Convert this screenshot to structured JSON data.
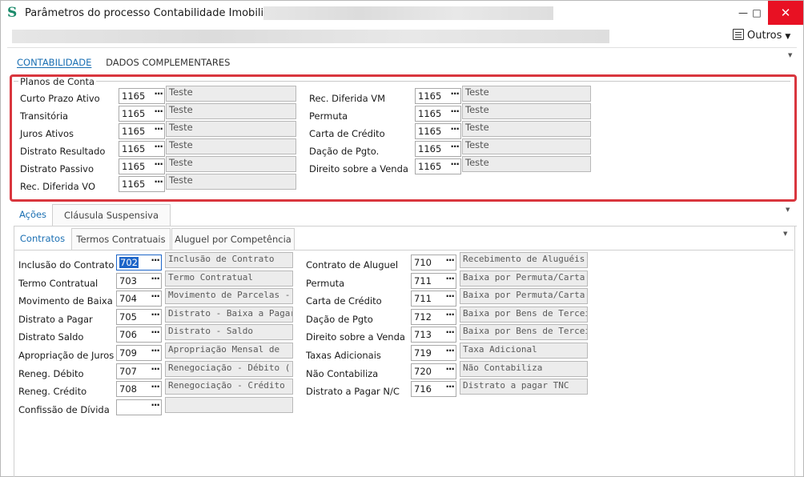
{
  "window": {
    "title": "Parâmetros do processo Contabilidade Imobiliária",
    "app_icon": "S",
    "minimize_glyph": "—",
    "maximize_glyph": "□",
    "close_glyph": "✕"
  },
  "toolbar": {
    "outros_label": "Outros",
    "outros_caret": "▼"
  },
  "main_tabs": [
    {
      "label": "CONTABILIDADE",
      "active": true
    },
    {
      "label": "DADOS COMPLEMENTARES",
      "active": false
    }
  ],
  "planos": {
    "title": "Planos de Conta",
    "left": [
      {
        "label": "Curto Prazo Ativo",
        "code": "1165",
        "desc": "Teste"
      },
      {
        "label": "Transitória",
        "code": "1165",
        "desc": "Teste"
      },
      {
        "label": "Juros Ativos",
        "code": "1165",
        "desc": "Teste"
      },
      {
        "label": "Distrato Resultado",
        "code": "1165",
        "desc": "Teste"
      },
      {
        "label": "Distrato Passivo",
        "code": "1165",
        "desc": "Teste"
      },
      {
        "label": "Rec. Diferida VO",
        "code": "1165",
        "desc": "Teste"
      }
    ],
    "right": [
      {
        "label": "Rec. Diferida VM",
        "code": "1165",
        "desc": "Teste"
      },
      {
        "label": "Permuta",
        "code": "1165",
        "desc": "Teste"
      },
      {
        "label": "Carta de Crédito",
        "code": "1165",
        "desc": "Teste"
      },
      {
        "label": "Dação de Pgto.",
        "code": "1165",
        "desc": "Teste"
      },
      {
        "label": "Direito sobre a Venda",
        "code": "1165",
        "desc": "Teste"
      }
    ]
  },
  "section_tabs": [
    {
      "label": "Ações",
      "active": true
    },
    {
      "label": "Cláusula Suspensiva",
      "active": false
    }
  ],
  "contract_tabs": [
    {
      "label": "Contratos",
      "active": true
    },
    {
      "label": "Termos Contratuais",
      "active": false
    },
    {
      "label": "Aluguel por Competência",
      "active": false
    }
  ],
  "ellipsis": "···",
  "acoes": {
    "left": [
      {
        "label": "Inclusão do Contrato",
        "code": "702",
        "desc": "Inclusão de Contrato",
        "selected": true
      },
      {
        "label": "Termo Contratual",
        "code": "703",
        "desc": "Termo Contratual"
      },
      {
        "label": "Movimento de Baixa",
        "code": "704",
        "desc": "Movimento de Parcelas -"
      },
      {
        "label": "Distrato a Pagar",
        "code": "705",
        "desc": "Distrato - Baixa a Pagar"
      },
      {
        "label": "Distrato Saldo",
        "code": "706",
        "desc": "Distrato - Saldo"
      },
      {
        "label": "Apropriação de Juros",
        "code": "709",
        "desc": "Apropriação Mensal de"
      },
      {
        "label": "Reneg. Débito",
        "code": "707",
        "desc": "Renegociação - Débito ("
      },
      {
        "label": "Reneg. Crédito",
        "code": "708",
        "desc": "Renegociação - Crédito"
      },
      {
        "label": "Confissão de Dívida",
        "code": "",
        "desc": ""
      }
    ],
    "right": [
      {
        "label": "Contrato de Aluguel",
        "code": "710",
        "desc": "Recebimento de Aluguéis"
      },
      {
        "label": "Permuta",
        "code": "711",
        "desc": "Baixa por Permuta/Carta de"
      },
      {
        "label": "Carta de Crédito",
        "code": "711",
        "desc": "Baixa por Permuta/Carta de"
      },
      {
        "label": "Dação de Pgto",
        "code": "712",
        "desc": "Baixa por Bens de Terceiros -"
      },
      {
        "label": "Direito sobre a Venda",
        "code": "713",
        "desc": "Baixa por Bens de Terceiros -"
      },
      {
        "label": "Taxas Adicionais",
        "code": "719",
        "desc": "Taxa Adicional"
      },
      {
        "label": "Não Contabiliza",
        "code": "720",
        "desc": "Não Contabiliza"
      },
      {
        "label": "Distrato a Pagar N/C",
        "code": "716",
        "desc": "Distrato a pagar TNC"
      }
    ]
  },
  "colors": {
    "accent": "#1a6fb3",
    "highlight_frame": "#d9363e",
    "close_button": "#e81123",
    "selection": "#1e66c9"
  }
}
